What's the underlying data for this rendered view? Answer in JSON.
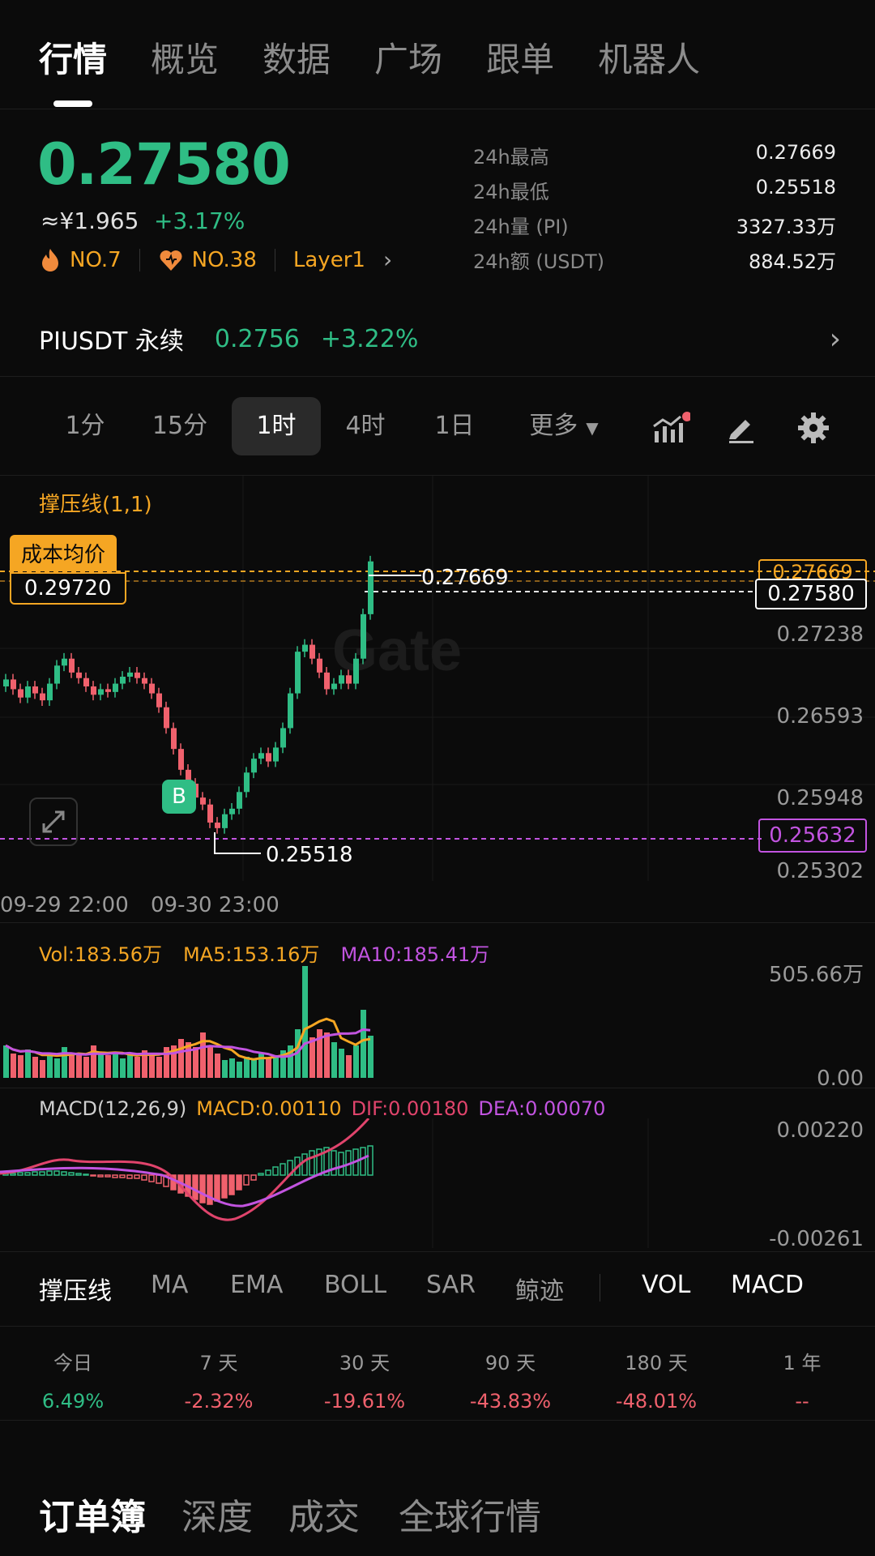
{
  "nav": {
    "tabs": [
      "行情",
      "概览",
      "数据",
      "广场",
      "跟单",
      "机器人"
    ]
  },
  "ticker": {
    "price": "0.27580",
    "cny": "≈¥1.965",
    "change": "+3.17%",
    "rank_hot": "NO.7",
    "rank_fav": "NO.38",
    "sector": "Layer1",
    "stats": [
      {
        "label": "24h最高",
        "value": "0.27669"
      },
      {
        "label": "24h最低",
        "value": "0.25518"
      },
      {
        "label": "24h量 (PI)",
        "value": "3327.33万"
      },
      {
        "label": "24h额 (USDT)",
        "value": "884.52万"
      }
    ]
  },
  "perp": {
    "name": "PIUSDT 永续",
    "price": "0.2756",
    "change": "+3.22%"
  },
  "timeframes": {
    "items": [
      "1分",
      "15分",
      "1时",
      "4时",
      "1日"
    ],
    "more": "更多",
    "active": "1时"
  },
  "chart": {
    "indicator_label": "撑压线(1,1)",
    "cost_label": "成本均价",
    "cost_value": "0.29720",
    "high_marker": "0.27669",
    "low_marker": "0.25518",
    "last_price": "0.27580",
    "right_top_tag": "0.27669",
    "level_tag": "0.25632",
    "y_ticks": [
      "0.27238",
      "0.26593",
      "0.25948",
      "0.25302"
    ],
    "x_ticks": [
      "09-29 22:00",
      "09-30 23:00"
    ],
    "buy_marker": "B",
    "watermark": "Gate"
  },
  "volume": {
    "vol": "Vol:183.56万",
    "ma5": "MA5:153.16万",
    "ma10": "MA10:185.41万",
    "y_max": "505.66万",
    "y_min": "0.00"
  },
  "macd": {
    "label": "MACD(12,26,9)",
    "macd": "MACD:0.00110",
    "dif": "DIF:0.00180",
    "dea": "DEA:0.00070",
    "y_max": "0.00220",
    "y_min": "-0.00261"
  },
  "indicators": {
    "main": [
      "撑压线",
      "MA",
      "EMA",
      "BOLL",
      "SAR",
      "鲸迹"
    ],
    "sub": [
      "VOL",
      "MACD"
    ]
  },
  "performance": [
    {
      "label": "今日",
      "value": "6.49%",
      "tone": "green"
    },
    {
      "label": "7 天",
      "value": "-2.32%",
      "tone": "red"
    },
    {
      "label": "30 天",
      "value": "-19.61%",
      "tone": "red"
    },
    {
      "label": "90 天",
      "value": "-43.83%",
      "tone": "red"
    },
    {
      "label": "180 天",
      "value": "-48.01%",
      "tone": "red"
    },
    {
      "label": "1 年",
      "value": "--",
      "tone": "red"
    }
  ],
  "bottom_tabs": [
    "订单簿",
    "深度",
    "成交",
    "全球行情"
  ],
  "colors": {
    "up": "#2fbd85",
    "down": "#f0616d",
    "accent": "#f5a623",
    "purple": "#c254e0"
  }
}
